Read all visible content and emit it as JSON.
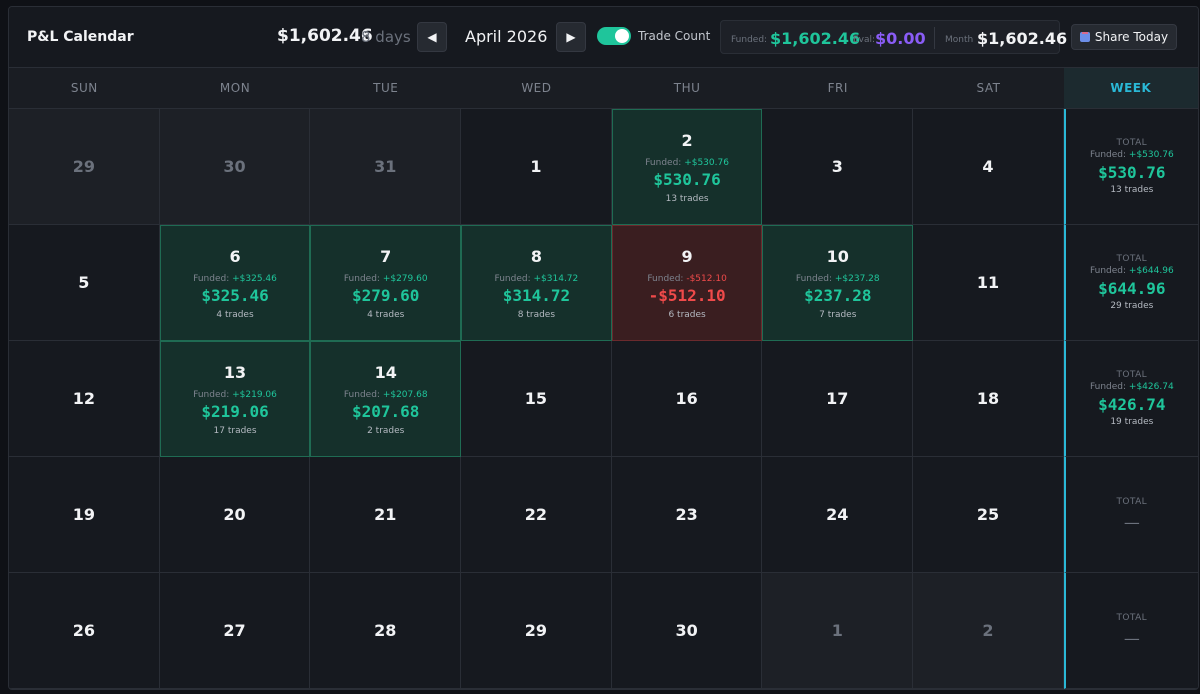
{
  "header": {
    "title": "P&L Calendar",
    "total": "$1,602.46",
    "days": "8 days",
    "month": "April 2026",
    "toggle_label": "Trade Count",
    "funded_label": "Funded:",
    "funded_value": "$1,602.46",
    "eval_label": "Eval:",
    "eval_value": "$0.00",
    "month_label": "Month",
    "month_value": "$1,602.46",
    "share_label": "Share Today",
    "prev_glyph": "◀",
    "next_glyph": "▶"
  },
  "colors": {
    "accent": "#2ab8d6",
    "positive": "#1fc59b",
    "negative": "#ef4a4a",
    "eval": "#8a5cf6"
  },
  "days_of_week": [
    "SUN",
    "MON",
    "TUE",
    "WED",
    "THU",
    "FRI",
    "SAT"
  ],
  "week_header": "WEEK",
  "funded_prefix": "Funded: ",
  "weeks": [
    {
      "days": [
        {
          "n": "29",
          "other": true
        },
        {
          "n": "30",
          "other": true
        },
        {
          "n": "31",
          "other": true
        },
        {
          "n": "1"
        },
        {
          "n": "2",
          "type": "pos",
          "funded": "+$530.76",
          "amt": "$530.76",
          "trades": "13 trades"
        },
        {
          "n": "3"
        },
        {
          "n": "4"
        }
      ],
      "summary": {
        "label": "TOTAL",
        "funded": "+$530.76",
        "amt": "$530.76",
        "trades": "13 trades"
      }
    },
    {
      "days": [
        {
          "n": "5"
        },
        {
          "n": "6",
          "type": "pos",
          "funded": "+$325.46",
          "amt": "$325.46",
          "trades": "4 trades"
        },
        {
          "n": "7",
          "type": "pos",
          "funded": "+$279.60",
          "amt": "$279.60",
          "trades": "4 trades"
        },
        {
          "n": "8",
          "type": "pos",
          "funded": "+$314.72",
          "amt": "$314.72",
          "trades": "8 trades"
        },
        {
          "n": "9",
          "type": "neg",
          "funded": "-$512.10",
          "amt": "-$512.10",
          "trades": "6 trades"
        },
        {
          "n": "10",
          "type": "pos",
          "funded": "+$237.28",
          "amt": "$237.28",
          "trades": "7 trades"
        },
        {
          "n": "11"
        }
      ],
      "summary": {
        "label": "TOTAL",
        "funded": "+$644.96",
        "amt": "$644.96",
        "trades": "29 trades"
      }
    },
    {
      "days": [
        {
          "n": "12"
        },
        {
          "n": "13",
          "type": "pos",
          "funded": "+$219.06",
          "amt": "$219.06",
          "trades": "17 trades"
        },
        {
          "n": "14",
          "type": "pos",
          "funded": "+$207.68",
          "amt": "$207.68",
          "trades": "2 trades"
        },
        {
          "n": "15"
        },
        {
          "n": "16"
        },
        {
          "n": "17"
        },
        {
          "n": "18"
        }
      ],
      "summary": {
        "label": "TOTAL",
        "funded": "+$426.74",
        "amt": "$426.74",
        "trades": "19 trades"
      }
    },
    {
      "days": [
        {
          "n": "19"
        },
        {
          "n": "20"
        },
        {
          "n": "21"
        },
        {
          "n": "22"
        },
        {
          "n": "23"
        },
        {
          "n": "24"
        },
        {
          "n": "25"
        }
      ],
      "summary": {
        "label": "TOTAL",
        "empty": "—"
      }
    },
    {
      "days": [
        {
          "n": "26"
        },
        {
          "n": "27"
        },
        {
          "n": "28"
        },
        {
          "n": "29"
        },
        {
          "n": "30"
        },
        {
          "n": "1",
          "other": true
        },
        {
          "n": "2",
          "other": true
        }
      ],
      "summary": {
        "label": "TOTAL",
        "empty": "—"
      }
    }
  ]
}
